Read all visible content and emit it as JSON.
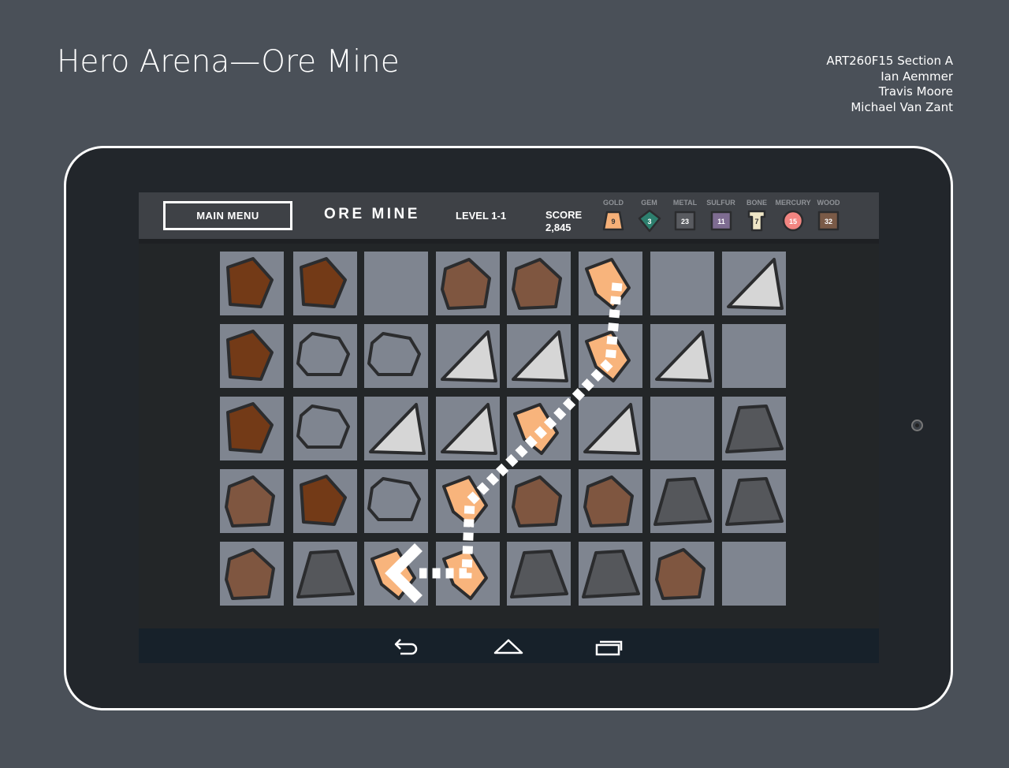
{
  "page": {
    "title": "Hero Arena—Ore Mine",
    "credits": [
      "ART260F15 Section A",
      "Ian Aemmer",
      "Travis Moore",
      "Michael Van Zant"
    ]
  },
  "hud": {
    "main_menu_label": "MAIN MENU",
    "game_title": "ORE MINE",
    "level_label": "LEVEL 1-1",
    "score_label": "SCORE",
    "score_value": "2,845",
    "resources": [
      {
        "name": "GOLD",
        "count": "9",
        "icon": "gold-icon",
        "color": "#f6b078"
      },
      {
        "name": "GEM",
        "count": "3",
        "icon": "gem-icon",
        "color": "#2d7f6e"
      },
      {
        "name": "METAL",
        "count": "23",
        "icon": "metal-icon",
        "color": "#595b60"
      },
      {
        "name": "SULFUR",
        "count": "11",
        "icon": "sulfur-icon",
        "color": "#7e6c91"
      },
      {
        "name": "BONE",
        "count": "7",
        "icon": "bone-icon",
        "color": "#efe6c6"
      },
      {
        "name": "MERCURY",
        "count": "15",
        "icon": "mercury-icon",
        "color": "#f28581"
      },
      {
        "name": "WOOD",
        "count": "32",
        "icon": "wood-icon",
        "color": "#7a5a47"
      }
    ]
  },
  "board": {
    "rows": [
      [
        "copper",
        "copper",
        "empty",
        "dirt",
        "dirt",
        "gold",
        "empty",
        "silver"
      ],
      [
        "copper",
        "stone",
        "stone",
        "silver",
        "silver",
        "gold",
        "silver",
        "empty"
      ],
      [
        "copper",
        "stone",
        "silver",
        "silver",
        "gold",
        "silver",
        "empty",
        "coal"
      ],
      [
        "dirt",
        "copper",
        "stone",
        "gold",
        "dirt",
        "dirt",
        "coal",
        "coal"
      ],
      [
        "dirt",
        "coal",
        "gold",
        "gold",
        "coal",
        "coal",
        "dirt",
        "empty"
      ]
    ],
    "selection_path": [
      [
        0,
        5
      ],
      [
        1,
        5
      ],
      [
        2,
        4
      ],
      [
        3,
        3
      ],
      [
        4,
        3
      ],
      [
        4,
        2
      ]
    ],
    "colors": {
      "cell": "#7f8590",
      "outline": "#2b2c2e",
      "copper": "#733a17",
      "dirt": "#7f5640",
      "stone": "#7f8590",
      "silver": "#d6d6d6",
      "gold": "#f8b47c",
      "coal": "#55575b"
    }
  },
  "navbar": {
    "buttons": [
      "back-icon",
      "home-icon",
      "recents-icon"
    ]
  }
}
